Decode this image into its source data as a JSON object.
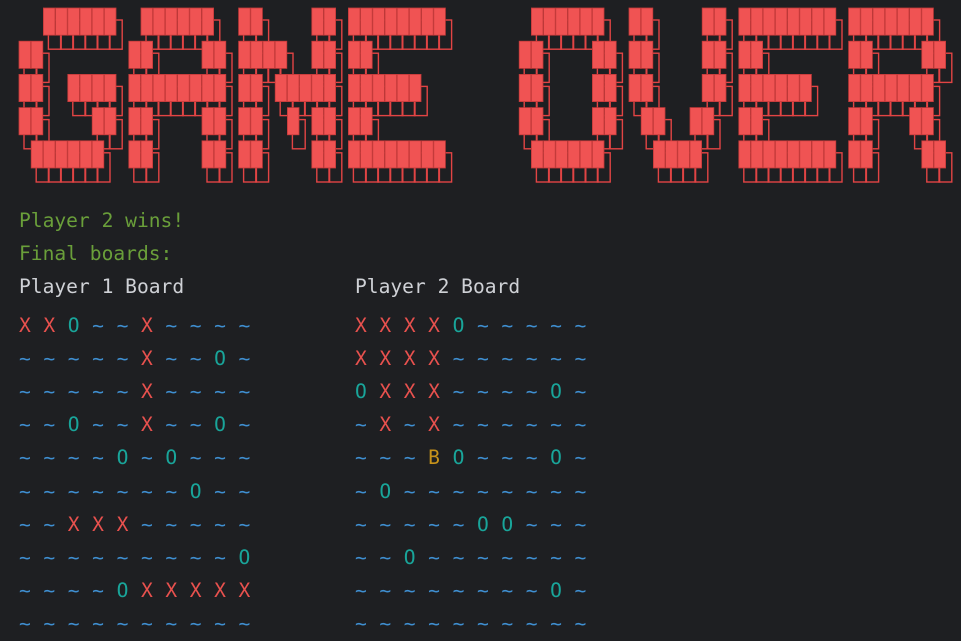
{
  "banner": {
    "text": "GAME OVER",
    "colors": {
      "fill": "#f05353",
      "outline": "#e24444"
    }
  },
  "status": {
    "winner_line": "Player 2 wins!",
    "final_boards_line": "Final boards:"
  },
  "legend": {
    "water": "~",
    "hit": "X",
    "miss": "O",
    "boat": "B",
    "colors": {
      "water": "#3f8fd1",
      "hit": "#e8514e",
      "miss": "#19a59a",
      "boat": "#c7921a"
    }
  },
  "boards": [
    {
      "title": "Player 1 Board",
      "rows": [
        "X X O ~ ~ X ~ ~ ~ ~",
        "~ ~ ~ ~ ~ X ~ ~ O ~",
        "~ ~ ~ ~ ~ X ~ ~ ~ ~",
        "~ ~ O ~ ~ X ~ ~ O ~",
        "~ ~ ~ ~ O ~ O ~ ~ ~",
        "~ ~ ~ ~ ~ ~ ~ O ~ ~",
        "~ ~ X X X ~ ~ ~ ~ ~",
        "~ ~ ~ ~ ~ ~ ~ ~ ~ O",
        "~ ~ ~ ~ O X X X X X",
        "~ ~ ~ ~ ~ ~ ~ ~ ~ ~"
      ]
    },
    {
      "title": "Player 2 Board",
      "rows": [
        "X X X X O ~ ~ ~ ~ ~",
        "X X X X ~ ~ ~ ~ ~ ~",
        "O X X X ~ ~ ~ ~ O ~",
        "~ X ~ X ~ ~ ~ ~ ~ ~",
        "~ ~ ~ B O ~ ~ ~ O ~",
        "~ O ~ ~ ~ ~ ~ ~ ~ ~",
        "~ ~ ~ ~ ~ O O ~ ~ ~",
        "~ ~ O ~ ~ ~ ~ ~ ~ ~",
        "~ ~ ~ ~ ~ ~ ~ ~ O ~",
        "~ ~ ~ ~ ~ ~ ~ ~ ~ ~"
      ]
    }
  ]
}
